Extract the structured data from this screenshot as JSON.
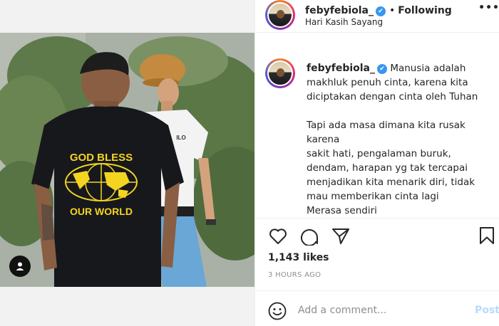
{
  "post": {
    "username": "febyfebiola_",
    "verified_mark": "✔",
    "separator": "•",
    "follow_status": "Following",
    "location": "Hari Kasih Sayang",
    "more_label": "•••"
  },
  "media": {
    "shirt_print_top": "GOD BLESS",
    "shirt_print_bottom": "OUR WORLD",
    "shirt_logo": "ILO"
  },
  "caption": {
    "username": "febyfebiola_",
    "lines": [
      "Manusia adalah",
      "makhluk penuh cinta, karena kita",
      "diciptakan dengan cinta oleh Tuhan",
      "",
      "Tapi ada masa dimana kita rusak",
      "karena",
      "sakit hati, pengalaman buruk,",
      "dendam, harapan yg tak tercapai",
      "menjadikan kita menarik diri, tidak",
      "mau memberikan cinta lagi",
      "Merasa sendiri"
    ]
  },
  "engagement": {
    "likes": "1,143 likes",
    "timestamp": "3 HOURS AGO"
  },
  "comment": {
    "placeholder": "Add a comment...",
    "post_label": "Post"
  },
  "icons": {
    "like": "heart-icon",
    "comment": "comment-icon",
    "share": "paper-plane-icon",
    "save": "bookmark-icon",
    "emoji": "smiley-icon",
    "tag": "user-tag-icon",
    "verified": "verified-badge-icon"
  },
  "colors": {
    "verified_blue": "#3897f0",
    "post_disabled": "#b3dbff",
    "muted_text": "#8e8e8e",
    "text": "#262626",
    "divider": "#efefef"
  }
}
